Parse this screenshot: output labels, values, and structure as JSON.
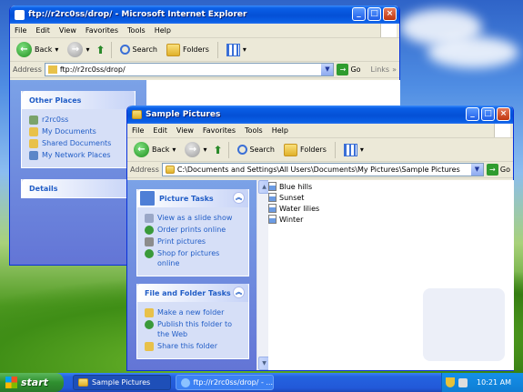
{
  "ftp_window": {
    "title": "ftp://r2rc0ss/drop/ - Microsoft Internet Explorer",
    "menu": [
      "File",
      "Edit",
      "View",
      "Favorites",
      "Tools",
      "Help"
    ],
    "toolbar": {
      "back": "Back",
      "search": "Search",
      "folders": "Folders"
    },
    "address_label": "Address",
    "address_value": "ftp://r2rc0ss/drop/",
    "go_label": "Go",
    "links_label": "Links",
    "other_places_title": "Other Places",
    "other_places": [
      "r2rc0ss",
      "My Documents",
      "Shared Documents",
      "My Network Places"
    ],
    "details_title": "Details"
  },
  "sample_window": {
    "title": "Sample Pictures",
    "menu": [
      "File",
      "Edit",
      "View",
      "Favorites",
      "Tools",
      "Help"
    ],
    "toolbar": {
      "back": "Back",
      "search": "Search",
      "folders": "Folders"
    },
    "address_label": "Address",
    "address_value": "C:\\Documents and Settings\\All Users\\Documents\\My Pictures\\Sample Pictures",
    "go_label": "Go",
    "picture_tasks_title": "Picture Tasks",
    "picture_tasks": [
      "View as a slide show",
      "Order prints online",
      "Print pictures",
      "Shop for pictures online"
    ],
    "file_tasks_title": "File and Folder Tasks",
    "file_tasks": [
      "Make a new folder",
      "Publish this folder to the Web",
      "Share this folder"
    ],
    "files": [
      "Blue hills",
      "Sunset",
      "Water lilies",
      "Winter"
    ]
  },
  "taskbar": {
    "start_label": "start",
    "tasks": [
      "Sample Pictures",
      "ftp://r2rc0ss/drop/ - ..."
    ],
    "clock": "10:21 AM"
  }
}
